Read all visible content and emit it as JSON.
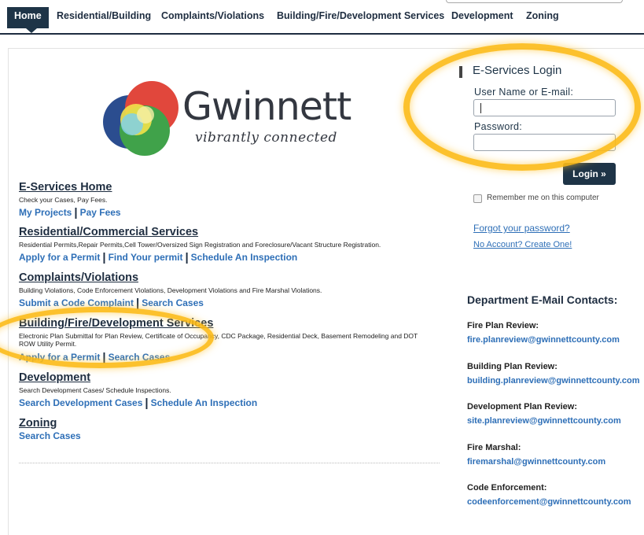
{
  "nav": {
    "items": [
      {
        "label": "Home",
        "active": true
      },
      {
        "label": "Residential/Building"
      },
      {
        "label": "Complaints/Violations"
      },
      {
        "label": "Building/Fire/Development Services"
      },
      {
        "label": "Development"
      },
      {
        "label": "Zoning"
      }
    ]
  },
  "logo": {
    "name": "Gwinnett",
    "tagline": "vibrantly connected"
  },
  "sections": [
    {
      "title": "E-Services Home",
      "desc": "Check your Cases, Pay Fees.",
      "links": [
        "My Projects",
        "Pay Fees"
      ]
    },
    {
      "title": "Residential/Commercial Services",
      "desc": "Residential Permits,Repair Permits,Cell Tower/Oversized Sign Registration and Foreclosure/Vacant Structure Registration.",
      "links": [
        "Apply for a Permit",
        "Find Your permit",
        "Schedule An Inspection"
      ]
    },
    {
      "title": "Complaints/Violations",
      "desc": "Building Violations, Code Enforcement Violations, Development Violations and Fire Marshal Violations.",
      "links": [
        "Submit a Code Complaint",
        "Search Cases"
      ]
    },
    {
      "title": "Building/Fire/Development Services",
      "desc": "Electronic Plan Submittal for Plan Review, Certificate of Occupancy, CDC Package, Residential Deck, Basement Remodeling and DOT ROW Utility Permit.",
      "links": [
        "Apply for a Permit",
        "Search Cases"
      ]
    },
    {
      "title": "Development",
      "desc": "Search Development Cases/ Schedule Inspections.",
      "links": [
        "Search Development Cases",
        "Schedule An Inspection"
      ]
    },
    {
      "title": "Zoning",
      "desc": "",
      "links": [
        "Search Cases"
      ]
    }
  ],
  "login": {
    "title": "E-Services Login",
    "username_label": "User Name or E-mail:",
    "username_value": "",
    "password_label": "Password:",
    "password_value": "",
    "button": "Login »",
    "remember": "Remember me on this computer",
    "remember_checked": false,
    "forgot": "Forgot your password?",
    "create": "No Account? Create One!"
  },
  "contacts": {
    "title": "Department E-Mail Contacts:",
    "items": [
      {
        "role": "Fire Plan Review:",
        "email": "fire.planreview@gwinnettcounty.com"
      },
      {
        "role": "Building Plan Review:",
        "email": "building.planreview@gwinnettcounty.com"
      },
      {
        "role": "Development Plan Review:",
        "email": "site.planreview@gwinnettcounty.com"
      },
      {
        "role": "Fire Marshal:",
        "email": "firemarshal@gwinnettcounty.com"
      },
      {
        "role": "Code Enforcement:",
        "email": "codeenforcement@gwinnettcounty.com"
      }
    ]
  },
  "colors": {
    "navy": "#1e3447",
    "link": "#2e6fb7",
    "highlight": "#fcba16"
  }
}
